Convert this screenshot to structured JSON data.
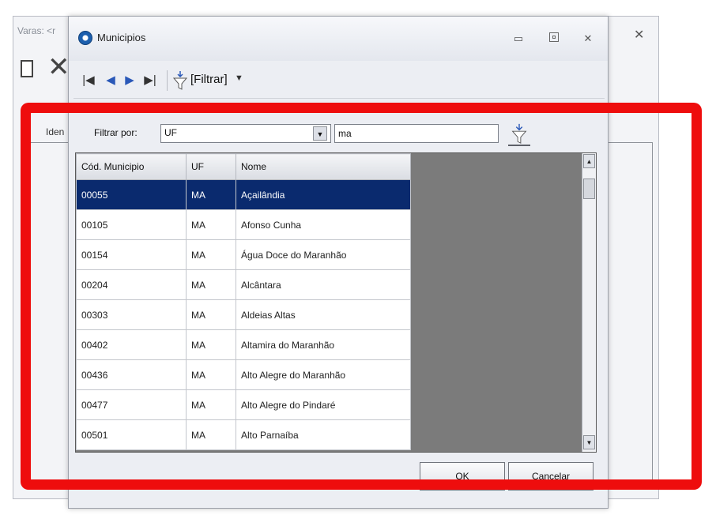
{
  "parent": {
    "title": "Varas: <r",
    "close_icon": "close-icon",
    "id_label": "Iden"
  },
  "dialog": {
    "title": "Municipios",
    "icon": "app-circle-icon",
    "toolbar": {
      "filter_label": "[Filtrar]",
      "first_icon": "first-record-icon",
      "prev_icon": "prev-record-icon",
      "next_icon": "next-record-icon",
      "last_icon": "last-record-icon",
      "filter_icon": "funnel-icon"
    },
    "filter_bar": {
      "label": "Filtrar por:",
      "field_value": "UF",
      "search_value": "ma"
    },
    "grid": {
      "columns": [
        "Cód. Municipio",
        "UF",
        "Nome"
      ],
      "rows": [
        [
          "00055",
          "MA",
          "Açailândia"
        ],
        [
          "00105",
          "MA",
          "Afonso Cunha"
        ],
        [
          "00154",
          "MA",
          "Água Doce do Maranhão"
        ],
        [
          "00204",
          "MA",
          "Alcântara"
        ],
        [
          "00303",
          "MA",
          "Aldeias Altas"
        ],
        [
          "00402",
          "MA",
          "Altamira do Maranhão"
        ],
        [
          "00436",
          "MA",
          "Alto Alegre do Maranhão"
        ],
        [
          "00477",
          "MA",
          "Alto Alegre do Pindaré"
        ],
        [
          "00501",
          "MA",
          "Alto Parnaíba"
        ]
      ],
      "selected_row": 0
    },
    "buttons": {
      "ok": "OK",
      "cancel": "Cancelar"
    }
  },
  "colors": {
    "highlight": "#ee0d0d",
    "selection": "#0a2a6e"
  }
}
